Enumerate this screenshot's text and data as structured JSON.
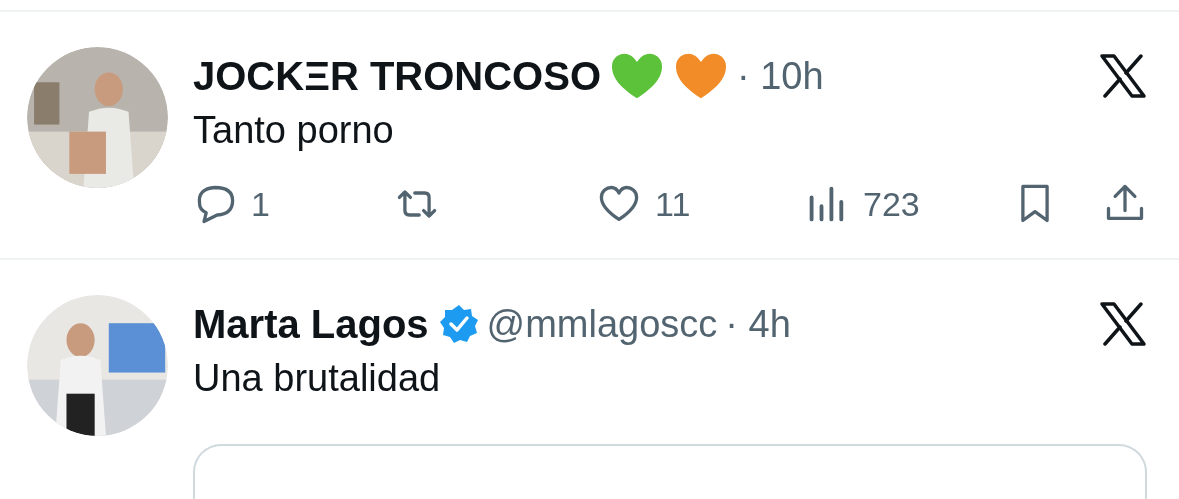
{
  "tweets": [
    {
      "name": "JOCKΞR TRONCOSO",
      "hearts": [
        {
          "color": "#5cc23a"
        },
        {
          "color": "#f28c28"
        }
      ],
      "time": "· 10h",
      "text": "Tanto porno",
      "actions": [
        {
          "kind": "reply",
          "count": "1"
        },
        {
          "kind": "repost"
        },
        {
          "kind": "like",
          "count": "11"
        },
        {
          "kind": "views",
          "count": "723"
        },
        {
          "kind": "bookmark"
        },
        {
          "kind": "share"
        }
      ]
    },
    {
      "name": "Marta Lagos",
      "verified": true,
      "handle": "@mmlagoscc",
      "time": "· 4h",
      "text": "Una brutalidad",
      "quoted": true
    }
  ]
}
